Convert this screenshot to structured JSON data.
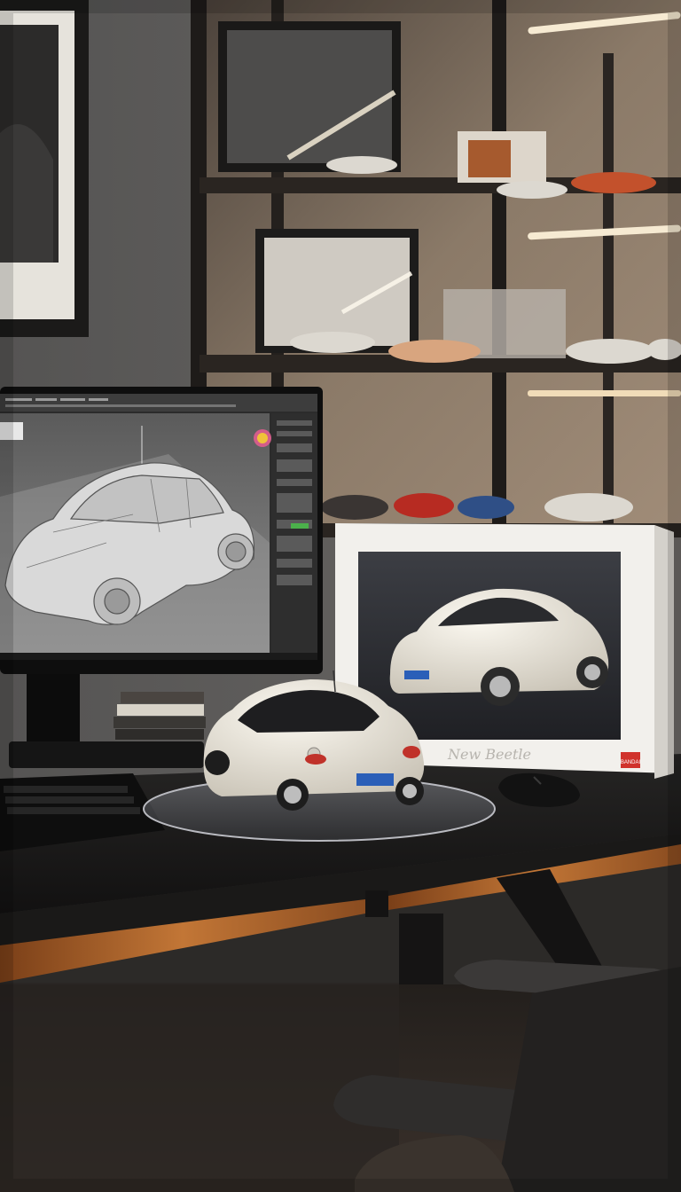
{
  "scene": {
    "description_free": true,
    "box_brand": "BANDAI",
    "box_script": "New Beetle",
    "colors": {
      "wall": "#6b6a68",
      "shelf_back": "#8a7a6a",
      "shelf_light": "#f3e6cc",
      "desk": "#1c1b1b",
      "desk_edge": "#b56a2e",
      "floor": "#2a2623",
      "car_body": "#ece8de",
      "monitor_bezel": "#111111",
      "viewport_bg": "#6e6e6e",
      "box_white": "#f2f0ec",
      "box_accent": "#d0322c"
    },
    "icons": [
      "monitor-icon",
      "keyboard-icon",
      "mouse-icon",
      "chair-icon"
    ]
  }
}
